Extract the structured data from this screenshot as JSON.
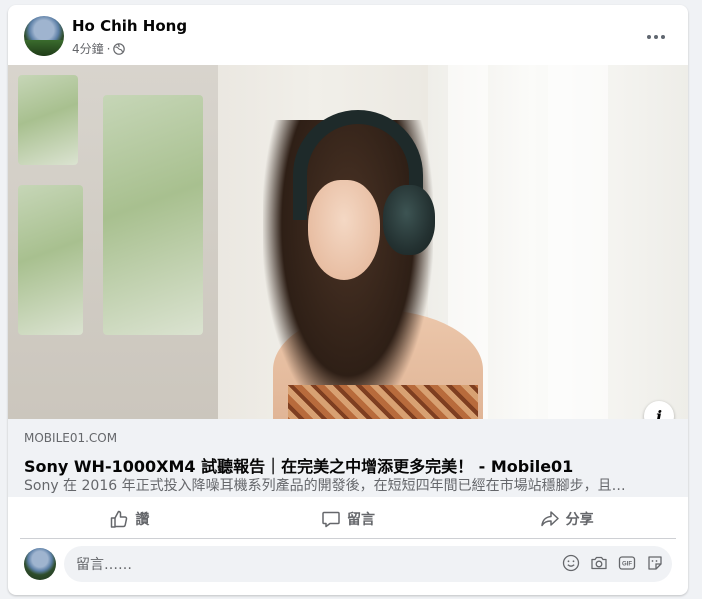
{
  "post": {
    "author": "Ho Chih Hong",
    "time": "4分鐘",
    "time_sep": "·",
    "privacy_icon": "globe-icon",
    "more_icon": "more-horizontal-icon"
  },
  "link": {
    "domain": "MOBILE01.COM",
    "title": "Sony WH-1000XM4 試聽報告｜在完美之中增添更多完美！ - Mobile01",
    "description": "Sony 在 2016 年正式投入降噪耳機系列產品的開發後，在短短四年間已經在市場站穩腳步，且…",
    "info_label": "i"
  },
  "actions": {
    "like": "讚",
    "comment": "留言",
    "share": "分享"
  },
  "comment_box": {
    "placeholder": "留言……",
    "tools": [
      "emoji-icon",
      "camera-icon",
      "gif-icon",
      "sticker-icon"
    ]
  },
  "colors": {
    "background": "#f0f2f5",
    "card": "#ffffff",
    "secondary_text": "#65676b",
    "primary_text": "#050505"
  }
}
